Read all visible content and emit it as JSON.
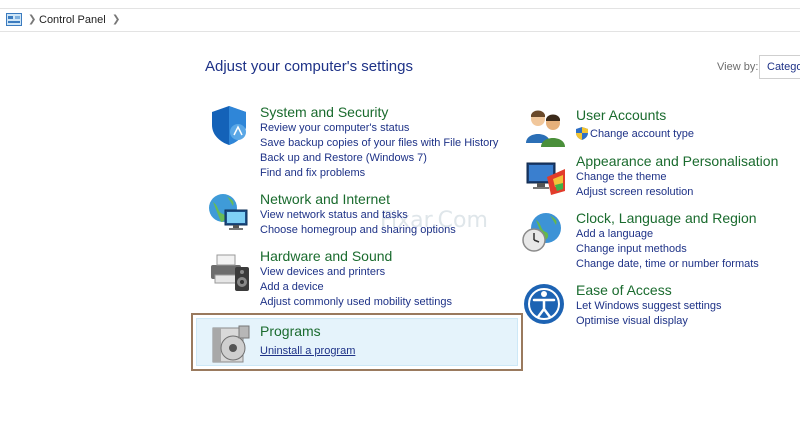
{
  "breadcrumb": {
    "current": "Control Panel"
  },
  "heading": "Adjust your computer's settings",
  "view_by": {
    "label": "View by:",
    "value": "Category"
  },
  "watermark": "Fixar.Com",
  "left_categories": [
    {
      "title": "System and Security",
      "icon": "shield-icon",
      "links": [
        "Review your computer's status",
        "Save backup copies of your files with File History",
        "Back up and Restore (Windows 7)",
        "Find and fix problems"
      ]
    },
    {
      "title": "Network and Internet",
      "icon": "network-globe-icon",
      "links": [
        "View network status and tasks",
        "Choose homegroup and sharing options"
      ]
    },
    {
      "title": "Hardware and Sound",
      "icon": "printer-speaker-icon",
      "links": [
        "View devices and printers",
        "Add a device",
        "Adjust commonly used mobility settings"
      ]
    },
    {
      "title": "Programs",
      "icon": "programs-disc-icon",
      "links": [
        "Uninstall a program"
      ]
    }
  ],
  "right_categories": [
    {
      "title": "User Accounts",
      "icon": "users-icon",
      "links": [
        "Change account type"
      ]
    },
    {
      "title": "Appearance and Personalisation",
      "icon": "monitor-palette-icon",
      "links": [
        "Change the theme",
        "Adjust screen resolution"
      ]
    },
    {
      "title": "Clock, Language and Region",
      "icon": "clock-globe-icon",
      "links": [
        "Add a language",
        "Change input methods",
        "Change date, time or number formats"
      ]
    },
    {
      "title": "Ease of Access",
      "icon": "ease-of-access-icon",
      "links": [
        "Let Windows suggest settings",
        "Optimise visual display"
      ]
    }
  ]
}
